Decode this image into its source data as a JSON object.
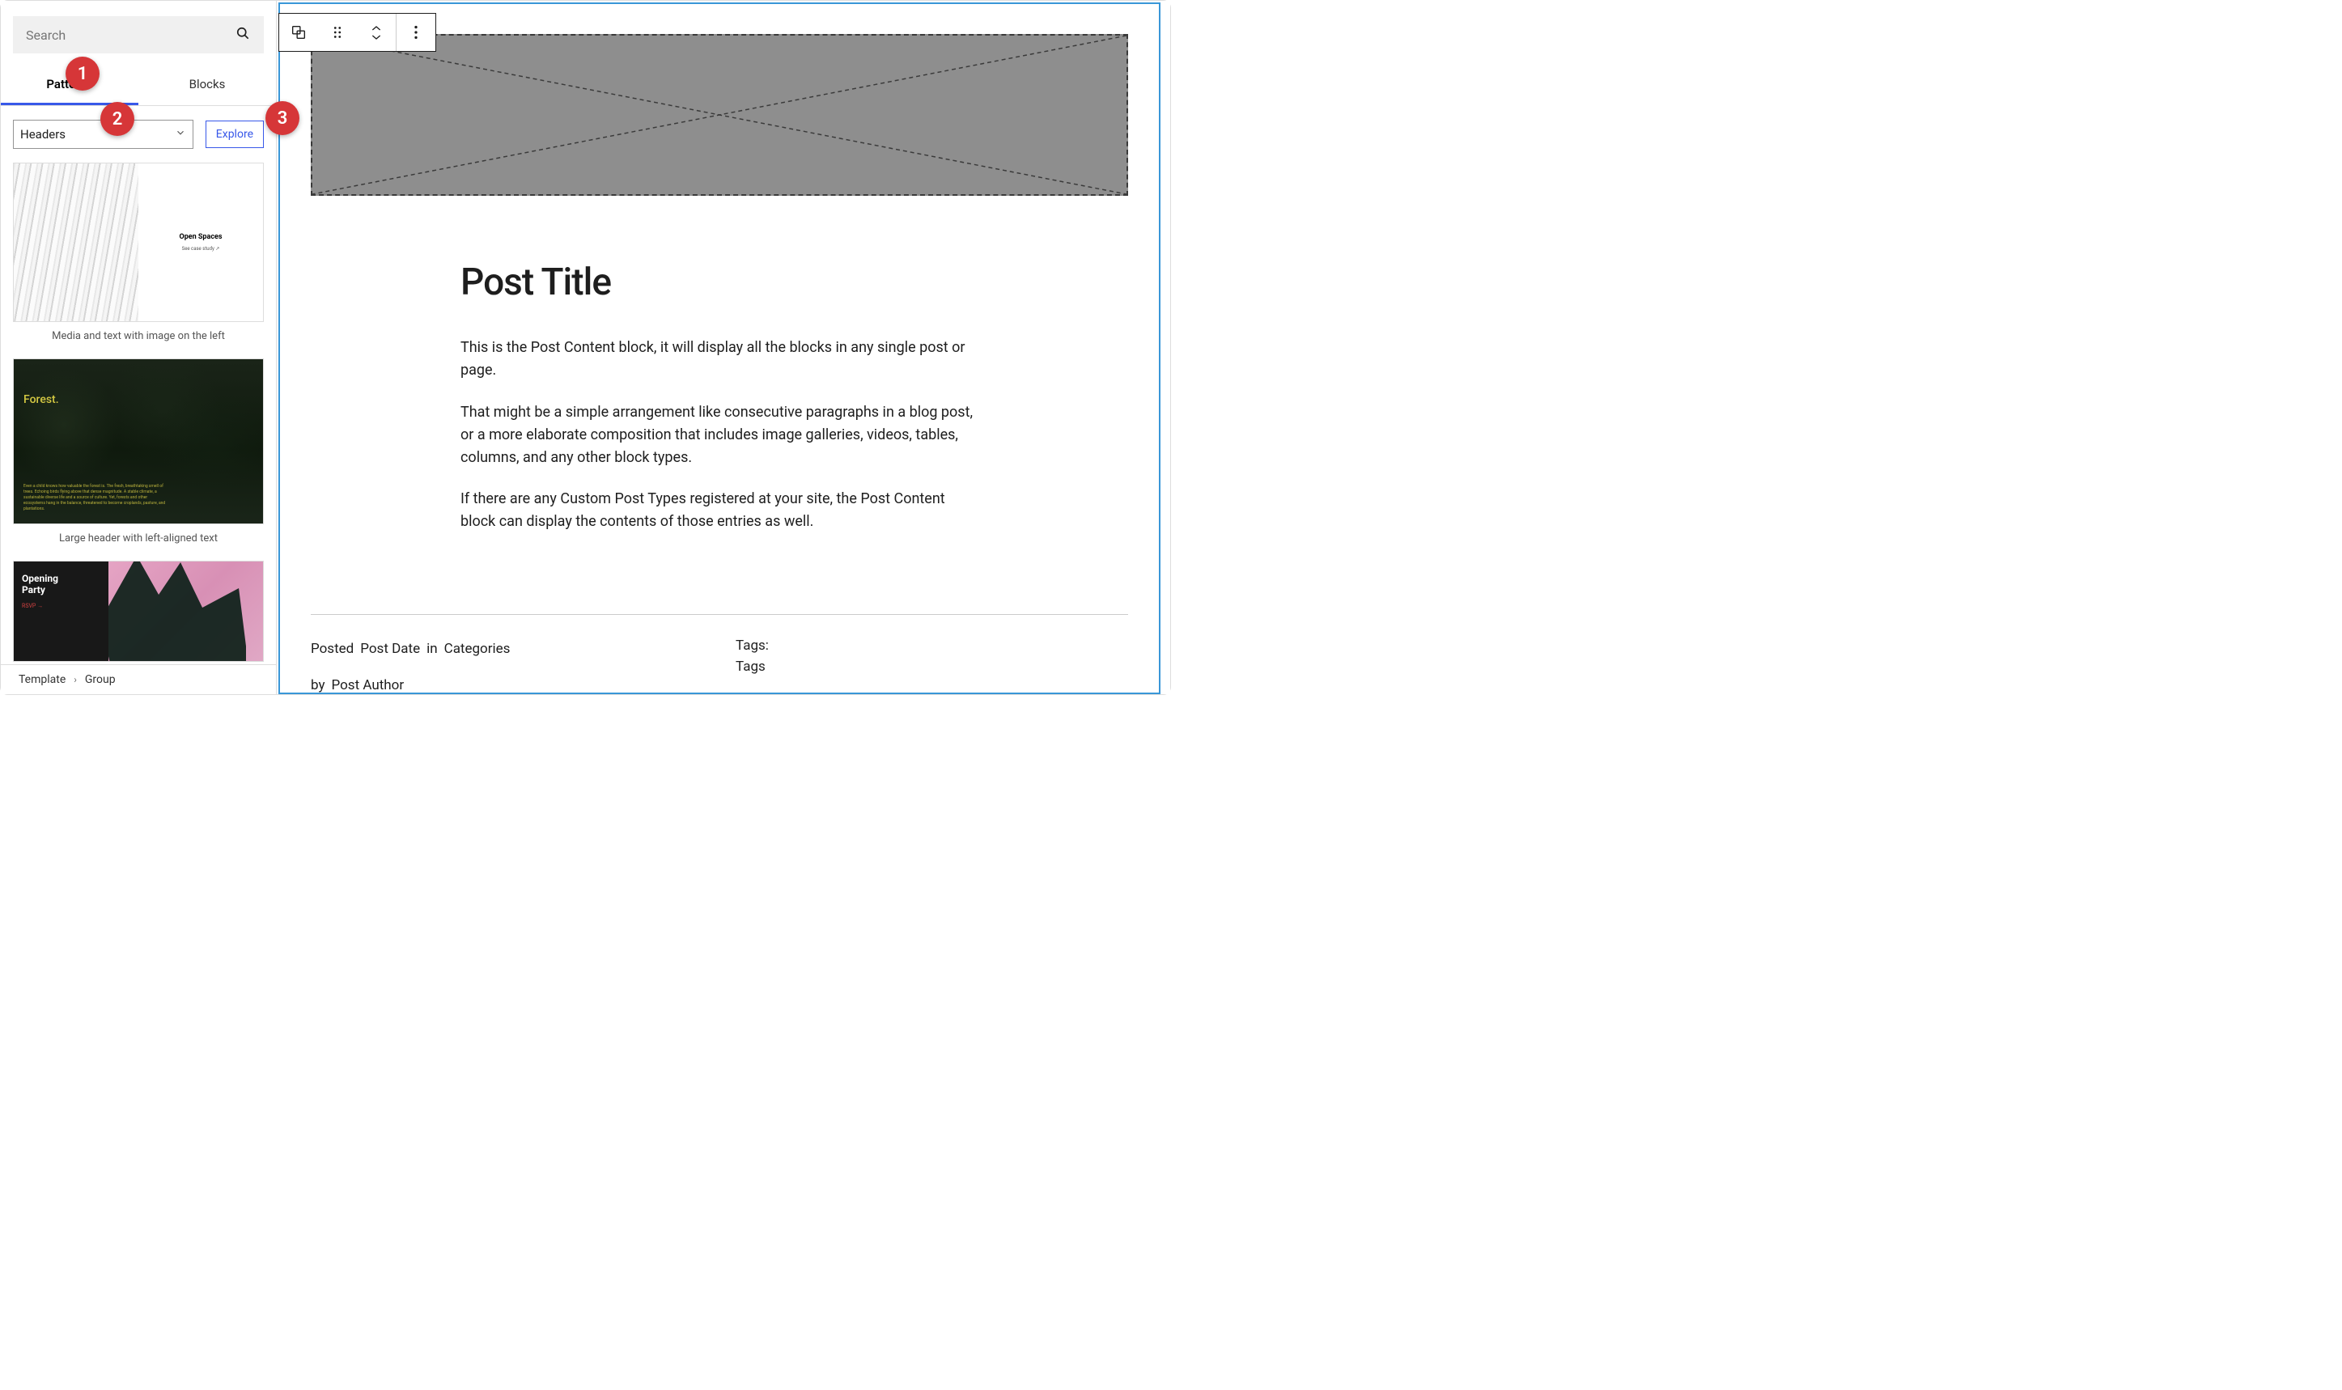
{
  "sidebar": {
    "search_placeholder": "Search",
    "tabs": {
      "patterns": "Patterns",
      "blocks": "Blocks",
      "active": "patterns"
    },
    "dropdown_value": "Headers",
    "explore_label": "Explore",
    "patterns": [
      {
        "name": "Media and text with image on the left",
        "preview_title": "Open Spaces",
        "preview_sub": "See case study ↗"
      },
      {
        "name": "Large header with left-aligned text",
        "preview_title": "Forest.",
        "preview_text": "Even a child knows how valuable the forest is. The fresh, breathtaking smell of trees. Echoing birds flying above that dense magnitude. A stable climate, a sustainable diverse life and a source of culture. Yet, forests and other ecosystems hang in the balance, threatened to become croplands, pasture, and plantations."
      },
      {
        "name": "",
        "preview_title": "Opening\nParty",
        "preview_sub": "RSVP →"
      }
    ]
  },
  "breadcrumb": {
    "root": "Template",
    "current": "Group"
  },
  "annotations": {
    "1": "1",
    "2": "2",
    "3": "3"
  },
  "editor": {
    "post_title": "Post Title",
    "paragraphs": [
      "This is the Post Content block, it will display all the blocks in any single post or page.",
      "That might be a simple arrangement like consecutive paragraphs in a blog post, or a more elaborate composition that includes image galleries, videos, tables, columns, and any other block types.",
      "If there are any Custom Post Types registered at your site, the Post Content block can display the contents of those entries as well."
    ],
    "meta": {
      "posted": "Posted",
      "post_date": "Post Date",
      "in": "in",
      "categories": "Categories",
      "by": "by",
      "post_author": "Post Author",
      "tags_label_1": "Tags:",
      "tags_label_2": "Tags"
    }
  }
}
